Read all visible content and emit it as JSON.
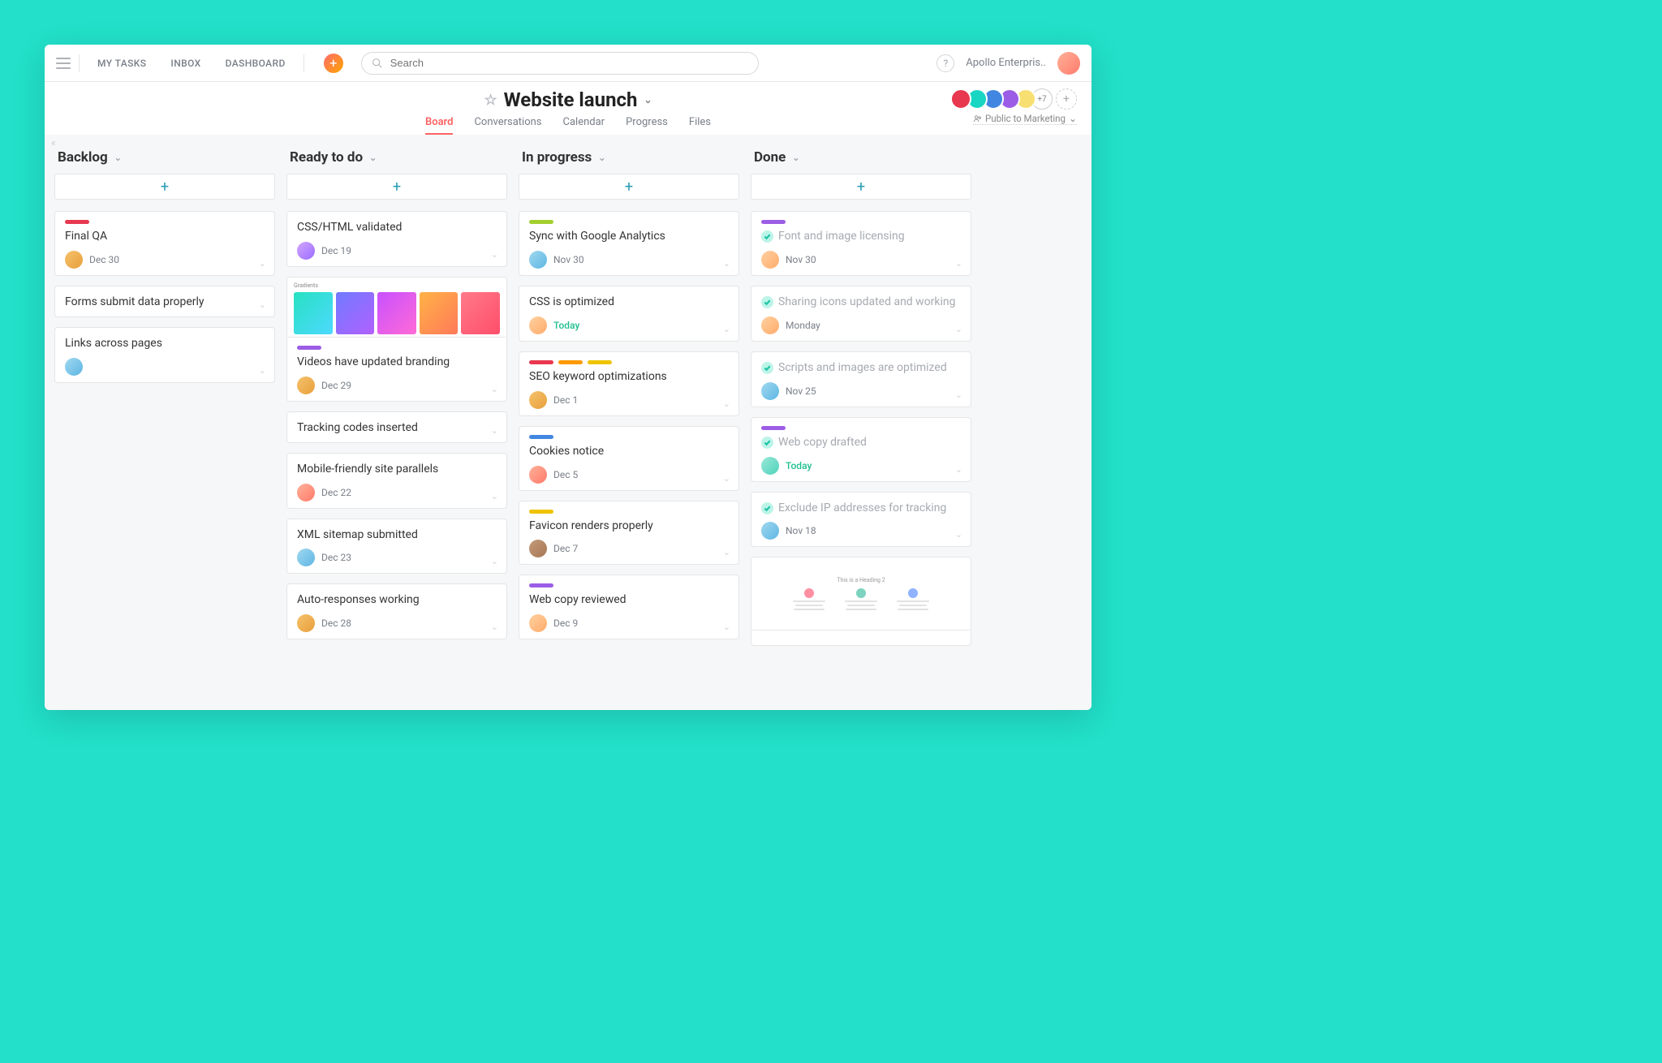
{
  "topbar": {
    "nav": {
      "my_tasks": "MY TASKS",
      "inbox": "INBOX",
      "dashboard": "DASHBOARD"
    },
    "search_placeholder": "Search",
    "workspace": "Apollo Enterpris.."
  },
  "project": {
    "title": "Website launch",
    "tabs": {
      "board": "Board",
      "conversations": "Conversations",
      "calendar": "Calendar",
      "progress": "Progress",
      "files": "Files"
    },
    "active_tab": "board",
    "member_overflow": "+7",
    "privacy": "Public to Marketing"
  },
  "columns": [
    {
      "title": "Backlog",
      "cards": [
        {
          "tags": [
            "red"
          ],
          "title": "Final QA",
          "avatar": "av-c",
          "date": "Dec 30"
        },
        {
          "tags": [],
          "title": "Forms submit data properly"
        },
        {
          "tags": [],
          "title": "Links across pages",
          "avatar": "av-b"
        }
      ]
    },
    {
      "title": "Ready to do",
      "cards": [
        {
          "tags": [],
          "title": "CSS/HTML validated",
          "avatar": "av-d",
          "date": "Dec 19"
        },
        {
          "image": "gradients",
          "tags": [
            "purple"
          ],
          "title": "Videos have updated branding",
          "avatar": "av-c",
          "date": "Dec 29"
        },
        {
          "tags": [],
          "title": "Tracking codes inserted"
        },
        {
          "tags": [],
          "title": "Mobile-friendly site parallels",
          "avatar": "av-a",
          "date": "Dec 22"
        },
        {
          "tags": [],
          "title": "XML sitemap submitted",
          "avatar": "av-b",
          "date": "Dec 23"
        },
        {
          "tags": [],
          "title": "Auto-responses working",
          "avatar": "av-c",
          "date": "Dec 28"
        }
      ]
    },
    {
      "title": "In progress",
      "cards": [
        {
          "tags": [
            "green"
          ],
          "title": "Sync with Google Analytics",
          "avatar": "av-b",
          "date": "Nov 30"
        },
        {
          "tags": [],
          "title": "CSS is optimized",
          "avatar": "av-e",
          "date": "Today",
          "today": true
        },
        {
          "tags": [
            "red",
            "orange",
            "yellow"
          ],
          "title": "SEO keyword optimizations",
          "avatar": "av-c",
          "date": "Dec 1"
        },
        {
          "tags": [
            "blue"
          ],
          "title": "Cookies notice",
          "avatar": "av-a",
          "date": "Dec 5"
        },
        {
          "tags": [
            "yellow"
          ],
          "title": "Favicon renders properly",
          "avatar": "av-g",
          "date": "Dec 7"
        },
        {
          "tags": [
            "purple"
          ],
          "title": "Web copy reviewed",
          "avatar": "av-e",
          "date": "Dec 9"
        }
      ]
    },
    {
      "title": "Done",
      "cards": [
        {
          "done": true,
          "tags": [
            "purple"
          ],
          "title": "Font and image licensing",
          "avatar": "av-e",
          "date": "Nov 30"
        },
        {
          "done": true,
          "tags": [],
          "title": "Sharing icons updated and working",
          "avatar": "av-e",
          "date": "Monday"
        },
        {
          "done": true,
          "tags": [],
          "title": "Scripts and images are optimized",
          "avatar": "av-b",
          "date": "Nov 25"
        },
        {
          "done": true,
          "tags": [
            "purple"
          ],
          "title": "Web copy drafted",
          "avatar": "av-f",
          "date": "Today",
          "today": true
        },
        {
          "done": true,
          "tags": [],
          "title": "Exclude IP addresses for tracking",
          "avatar": "av-b",
          "date": "Nov 18"
        },
        {
          "image": "mock"
        }
      ]
    }
  ]
}
